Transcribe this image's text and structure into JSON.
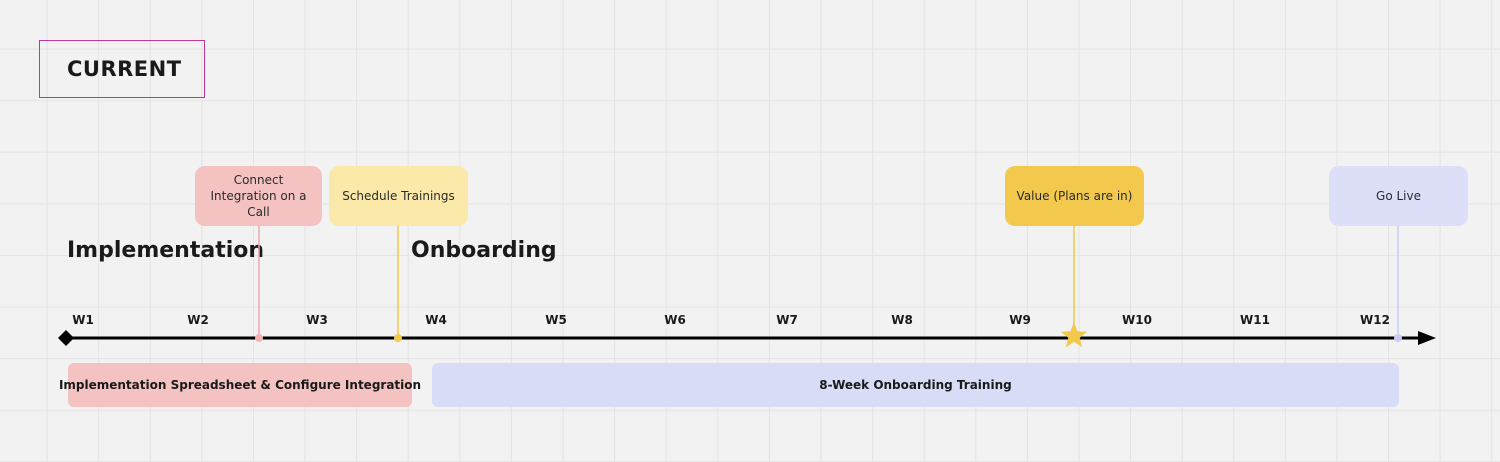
{
  "frame": {
    "title": "CURRENT"
  },
  "phases": [
    {
      "key": "implementation",
      "title": "Implementation"
    },
    {
      "key": "onboarding",
      "title": "Onboarding"
    }
  ],
  "weeks": [
    "W1",
    "W2",
    "W3",
    "W4",
    "W5",
    "W6",
    "W7",
    "W8",
    "W9",
    "W10",
    "W11",
    "W12"
  ],
  "milestones": [
    {
      "key": "connect-integration",
      "label": "Connect Integration on a Call",
      "color": "#f5c2c2",
      "line_color": "#f0a9a9"
    },
    {
      "key": "schedule-trainings",
      "label": "Schedule Trainings",
      "color": "#fae9a8",
      "line_color": "#f2c94c"
    },
    {
      "key": "value",
      "label": "Value (Plans are in)",
      "color": "#f2c94c",
      "line_color": "#f2c94c"
    },
    {
      "key": "go-live",
      "label": "Go Live",
      "color": "#dcdff7",
      "line_color": "#c9cdf3"
    }
  ],
  "spans": [
    {
      "key": "implementation-span",
      "label": "Implementation Spreadsheet & Configure Integration",
      "color": "#f5c2c2"
    },
    {
      "key": "onboarding-span",
      "label": "8-Week Onboarding Training",
      "color": "#d9dcf6"
    }
  ],
  "colors": {
    "frame_border": "#c0369a",
    "timeline": "#000000",
    "star": "#f2c94c",
    "background": "#f2f2f2"
  }
}
